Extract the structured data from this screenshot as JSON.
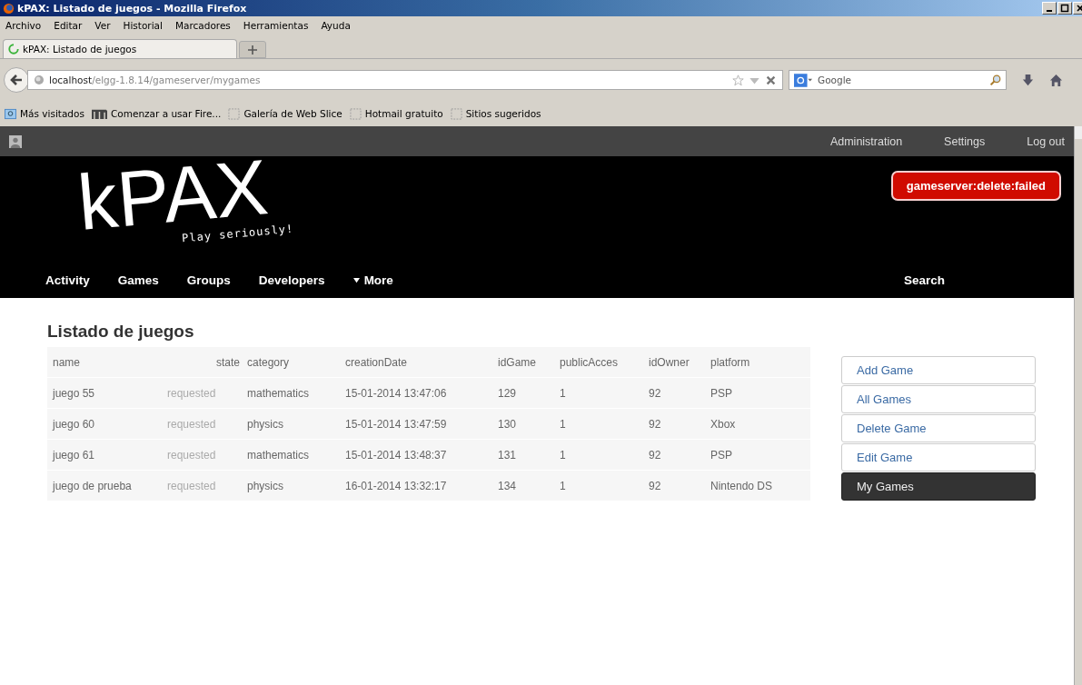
{
  "window": {
    "title": "kPAX: Listado de juegos - Mozilla Firefox"
  },
  "menu": [
    "Archivo",
    "Editar",
    "Ver",
    "Historial",
    "Marcadores",
    "Herramientas",
    "Ayuda"
  ],
  "tabs": [
    {
      "label": "kPAX: Listado de juegos",
      "selected": true,
      "loading": true
    }
  ],
  "address": {
    "host": "localhost",
    "path": "/elgg-1.8.14/gameserver/mygames"
  },
  "search_box": {
    "placeholder": "Google"
  },
  "bookmarks": [
    {
      "label": "Más visitados",
      "kind": "search"
    },
    {
      "label": "Comenzar a usar Fire...",
      "kind": "brand"
    },
    {
      "label": "Galería de Web Slice",
      "kind": "slice"
    },
    {
      "label": "Hotmail gratuito",
      "kind": "slice"
    },
    {
      "label": "Sitios sugeridos",
      "kind": "slice"
    }
  ],
  "topbar": {
    "links": [
      "Administration",
      "Settings",
      "Log out"
    ]
  },
  "header": {
    "logo": "kPAX",
    "tagline": "Play seriously!",
    "error": "gameserver:delete:failed"
  },
  "nav": {
    "items": [
      "Activity",
      "Games",
      "Groups",
      "Developers",
      "More"
    ],
    "search": "Search"
  },
  "page": {
    "title": "Listado de juegos"
  },
  "table": {
    "columns": [
      "name",
      "state",
      "category",
      "creationDate",
      "idGame",
      "publicAcces",
      "idOwner",
      "platform"
    ],
    "rows": [
      [
        "juego 55",
        "requested",
        "mathematics",
        "15-01-2014 13:47:06",
        "129",
        "1",
        "92",
        "PSP"
      ],
      [
        "juego 60",
        "requested",
        "physics",
        "15-01-2014 13:47:59",
        "130",
        "1",
        "92",
        "Xbox"
      ],
      [
        "juego 61",
        "requested",
        "mathematics",
        "15-01-2014 13:48:37",
        "131",
        "1",
        "92",
        "PSP"
      ],
      [
        "juego de prueba",
        "requested",
        "physics",
        "16-01-2014 13:32:17",
        "134",
        "1",
        "92",
        "Nintendo DS"
      ]
    ]
  },
  "sidebar": {
    "items": [
      {
        "label": "Add Game",
        "selected": false
      },
      {
        "label": "All Games",
        "selected": false
      },
      {
        "label": "Delete Game",
        "selected": false
      },
      {
        "label": "Edit Game",
        "selected": false
      },
      {
        "label": "My Games",
        "selected": true
      }
    ]
  }
}
